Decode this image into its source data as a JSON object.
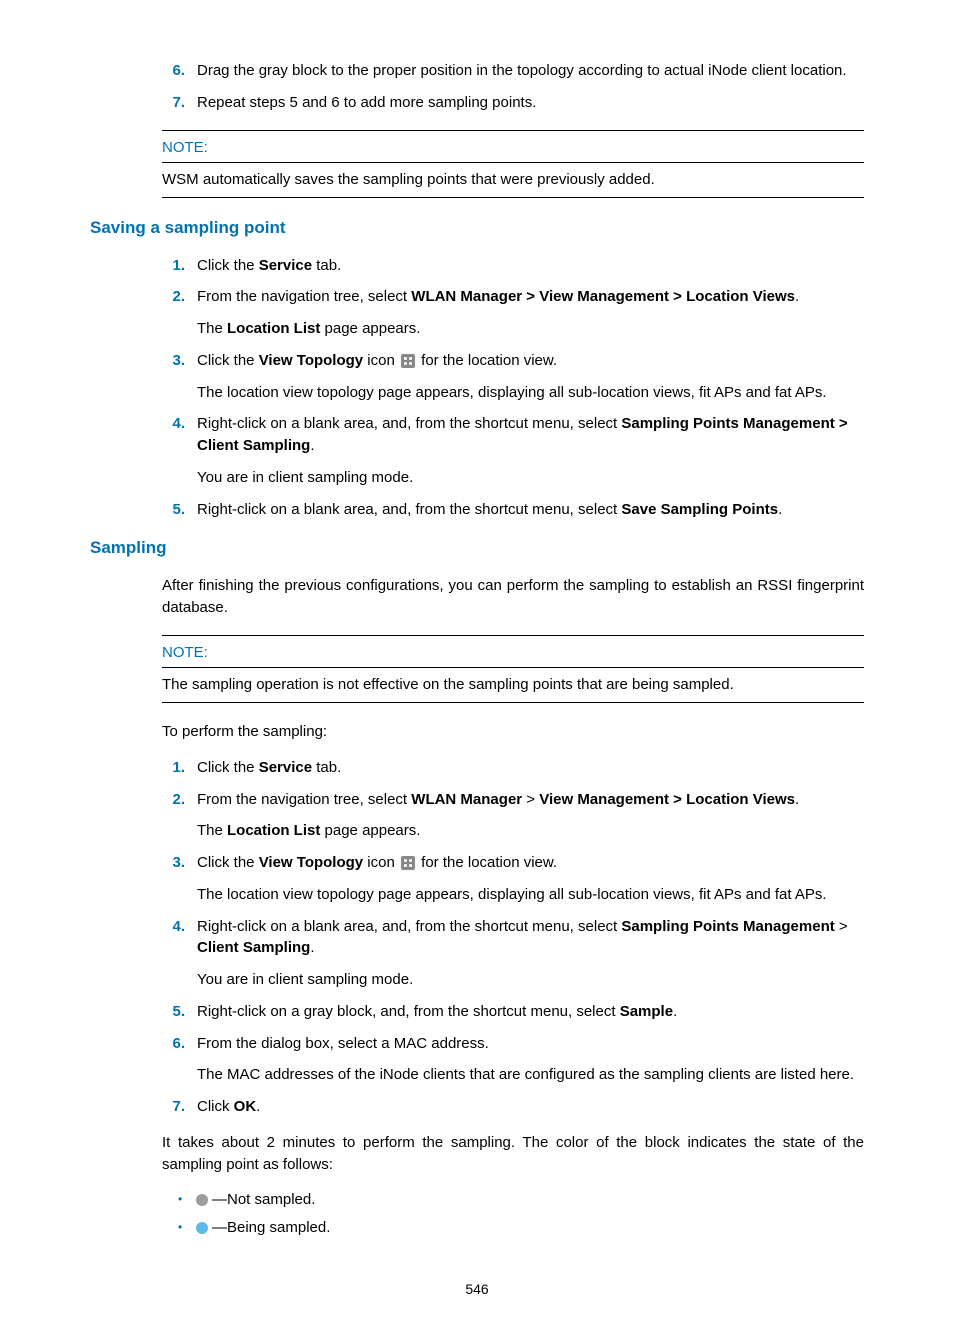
{
  "top": {
    "step6_num": "6.",
    "step6": "Drag the gray block to the proper position in the topology according to actual iNode client location.",
    "step7_num": "7.",
    "step7": "Repeat steps 5 and 6 to add more sampling points."
  },
  "note1": {
    "label": "NOTE:",
    "body": "WSM automatically saves the sampling points that were previously added."
  },
  "sec1": {
    "title": "Saving a sampling point",
    "s1n": "1.",
    "s1a": "Click the ",
    "s1b": "Service",
    "s1c": " tab.",
    "s2n": "2.",
    "s2a": "From the navigation tree, select ",
    "s2b": "WLAN Manager > View Management > Location Views",
    "s2c": ".",
    "s2sub_a": "The ",
    "s2sub_b": "Location List",
    "s2sub_c": " page appears.",
    "s3n": "3.",
    "s3a": "Click the ",
    "s3b": "View Topology",
    "s3c": " icon ",
    "s3d": " for the location view.",
    "s3sub": "The location view topology page appears, displaying all sub-location views, fit APs and fat APs.",
    "s4n": "4.",
    "s4a": "Right-click on a blank area, and, from the shortcut menu, select ",
    "s4b": "Sampling Points Management > Client Sampling",
    "s4c": ".",
    "s4sub": "You are in client sampling mode.",
    "s5n": "5.",
    "s5a": "Right-click on a blank area, and, from the shortcut menu, select ",
    "s5b": "Save Sampling Points",
    "s5c": "."
  },
  "sec2": {
    "title": "Sampling",
    "intro": "After finishing the previous configurations, you can perform the sampling to establish an RSSI fingerprint database."
  },
  "note2": {
    "label": "NOTE:",
    "body": "The sampling operation is not effective on the sampling points that are being sampled."
  },
  "perf": {
    "lead": "To perform the sampling:",
    "s1n": "1.",
    "s1a": "Click the ",
    "s1b": "Service",
    "s1c": " tab.",
    "s2n": "2.",
    "s2a": "From the navigation tree, select ",
    "s2b": "WLAN Manager",
    "s2c": " > ",
    "s2d": "View Management > Location Views",
    "s2e": ".",
    "s2sub_a": "The ",
    "s2sub_b": "Location List",
    "s2sub_c": " page appears.",
    "s3n": "3.",
    "s3a": "Click the ",
    "s3b": "View Topology",
    "s3c": " icon ",
    "s3d": " for the location view.",
    "s3sub": "The location view topology page appears, displaying all sub-location views, fit APs and fat APs.",
    "s4n": "4.",
    "s4a": "Right-click on a blank area, and, from the shortcut menu, select ",
    "s4b": "Sampling Points Management",
    "s4c": " > ",
    "s4d": "Client Sampling",
    "s4e": ".",
    "s4sub": "You are in client sampling mode.",
    "s5n": "5.",
    "s5a": "Right-click on a gray block, and, from the shortcut menu, select ",
    "s5b": "Sample",
    "s5c": ".",
    "s6n": "6.",
    "s6": "From the dialog box, select a MAC address.",
    "s6sub": "The MAC addresses of the iNode clients that are configured as the sampling clients are listed here.",
    "s7n": "7.",
    "s7a": "Click ",
    "s7b": "OK",
    "s7c": "."
  },
  "outro": "It takes about 2 minutes to perform the sampling. The color of the block indicates the state of the sampling point as follows:",
  "bullets": {
    "b1": "—Not sampled.",
    "b2": "—Being sampled."
  },
  "page": "546"
}
